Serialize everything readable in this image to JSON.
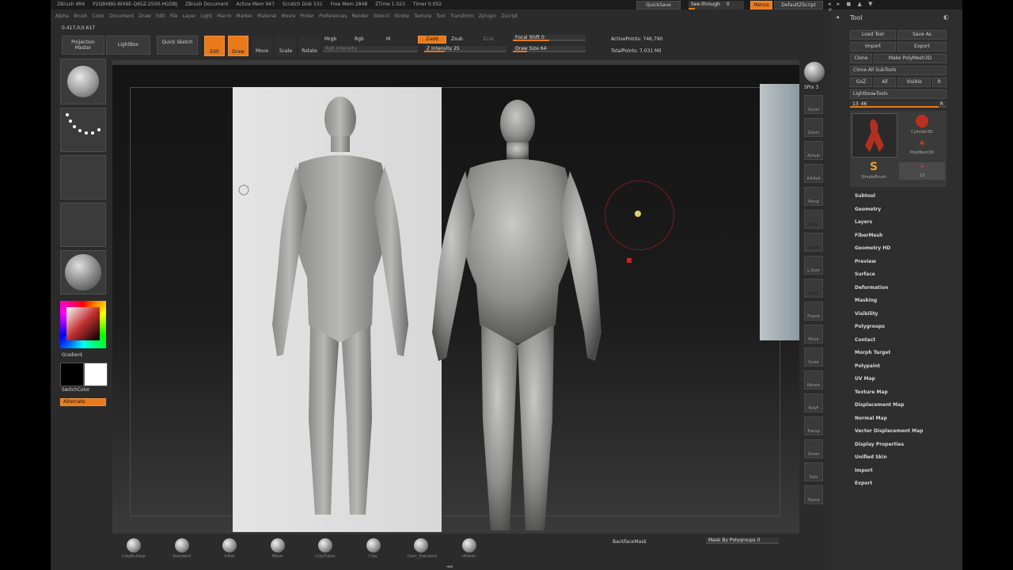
{
  "title_bar": {
    "app_version": "ZBrush 4R6",
    "session_id": "P2QBHBG-WX6E-Q6SZ-2500-HGDBJ",
    "document": "ZBrush Document",
    "active_mem": "Active Mem 947",
    "scratch_disk": "Scratch Disk 531",
    "free_mem": "Free Mem 2848",
    "ztime": "ZTime 1.023",
    "timer": "Timer 0.002",
    "quicksave": "QuickSave",
    "see_through": "See-through",
    "see_through_value": "0",
    "menus_label": "Menus",
    "default_script": "DefaultZScript"
  },
  "menu_bar": {
    "items": [
      "Alpha",
      "Brush",
      "Color",
      "Document",
      "Draw",
      "Edit",
      "File",
      "Layer",
      "Light",
      "Macro",
      "Marker",
      "Material",
      "Movie",
      "Picker",
      "Preferences",
      "Render",
      "Stencil",
      "Stroke",
      "Texture",
      "Tool",
      "Transform",
      "Zplugin",
      "Zscript"
    ]
  },
  "coords": "0.417,0,0.617",
  "top_shelf": {
    "projection_master": "Projection Master",
    "lightbox": "LightBox",
    "quick_sketch": "Quick Sketch",
    "edit": "Edit",
    "draw": "Draw",
    "move": "Move",
    "scale": "Scale",
    "rotate": "Rotate",
    "mrgb": "Mrgb",
    "rgb": "Rgb",
    "m": "M",
    "rgb_intensity": "Rgb Intensity",
    "zadd": "Zadd",
    "zsub": "Zsub",
    "zcut": "Zcut",
    "z_intensity_label": "Z Intensity",
    "z_intensity_value": "25",
    "z_intensity_pct": 0.25,
    "focal_shift_label": "Focal Shift",
    "focal_shift_value": "0",
    "focal_shift_pct": 0.5,
    "draw_size_label": "Draw Size",
    "draw_size_value": "64",
    "draw_size_pct": 0.2,
    "active_points": "ActivePoints: 746,790",
    "total_points": "TotalPoints: 7.031 Mil"
  },
  "left_shelf": {
    "gradient": "Gradient",
    "switch_color": "SwitchColor",
    "alternate": "Alternate"
  },
  "right_column": {
    "bpr": "BPR",
    "spix_label": "SPix",
    "spix_value": "3",
    "buttons": [
      "Scroll",
      "Zoom",
      "Actual",
      "AAHalf",
      "Persp",
      "Floor",
      "Local",
      "L.Sym",
      "Gxyz",
      "Frame",
      "Move",
      "Scale",
      "Rotate",
      "PolyF",
      "Transp",
      "Ghost",
      "Solo",
      "Xpose"
    ]
  },
  "tool_panel": {
    "title": "Tool",
    "load_tool": "Load Tool",
    "save_as": "Save As",
    "import": "Import",
    "export": "Export",
    "clone": "Clone",
    "make_polymesh": "Make PolyMesh3D",
    "clone_all": "Clone All SubTools",
    "goz": "GoZ",
    "all": "All",
    "visible": "Visible",
    "r": "R",
    "lightbox_tools": "Lightbox▸Tools",
    "current_tool": "13_46",
    "current_tool_value": "R",
    "thumb_cylinder": "Cylinder3D",
    "thumb_polymesh": "PolyMesh3D",
    "thumb_simple": "SimpleBrush",
    "thumb_13": "13",
    "sections": [
      "Subtool",
      "Geometry",
      "Layers",
      "FiberMesh",
      "Geometry HD",
      "Preview",
      "Surface",
      "Deformation",
      "Masking",
      "Visibility",
      "Polygroups",
      "Contact",
      "Morph Target",
      "Polypaint",
      "UV Map",
      "Texture Map",
      "Displacement Map",
      "Normal Map",
      "Vector Displacement Map",
      "Display Properties",
      "Unified Skin",
      "Import",
      "Export"
    ]
  },
  "bottom_shelf": {
    "brushes": [
      "ClayBuildup",
      "Standard",
      "Inflat",
      "Move",
      "ClayTubes",
      "Clay",
      "Dam_Standard",
      "hPolish"
    ],
    "backface_mask": "BackfaceMask",
    "mask_by_polygroups": "Mask By Polygroups",
    "mask_by_polygroups_value": "0"
  },
  "colors": {
    "accent": "#e87a1c",
    "ui_bg": "#2b2b2b",
    "canvas": "#1c1c1c"
  }
}
